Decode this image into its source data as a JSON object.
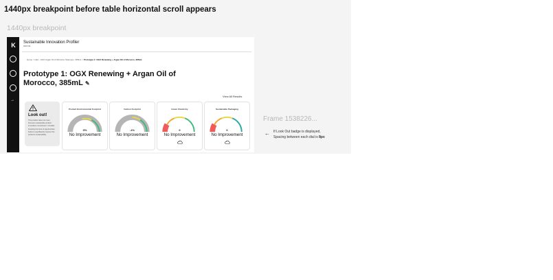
{
  "page_heading": "1440px breakpoint before table horizontal scroll appears",
  "breakpoint_label": "1440px breakpoint",
  "frame_label": "Frame 1538226...",
  "annotation": {
    "line1": "If Look Out badge is displayed,",
    "line2_prefix": "Spacing between each dial is ",
    "line2_value": "8px"
  },
  "app": {
    "title": "Sustainable Innovation Profiler",
    "subtitle": "KENVUE",
    "breadcrumb": [
      "Home",
      "LEA - OGX Argan Oil of Morocco Shampoo, 385mL",
      "Prototype 1: OGX Renewing + Argan Oil of Morocco, 385mL"
    ],
    "breadcrumb_sep": ">",
    "prototype_title": "Prototype 1: OGX Renewing + Argan Oil of Morocco, 385mL",
    "view_all": "View All Results",
    "lookout": {
      "title": "Look out!",
      "body": "This product does not meet Kenvue's sustainable product innovation commitment. Consider boosting the Area of opportunities below to significantly improve this product's sustainability."
    },
    "cards": [
      {
        "title": "Product Environmental Footprint",
        "value": "0%",
        "status": "No Improvement",
        "has_icon": false
      },
      {
        "title": "Carbon Footprint",
        "value": "-1%",
        "status": "No Improvement",
        "has_icon": false
      },
      {
        "title": "Green Chemistry",
        "value": "0",
        "status": "No Improvement",
        "has_icon": true
      },
      {
        "title": "Sustainable Packaging",
        "value": "0",
        "status": "No Improvement",
        "has_icon": true
      }
    ]
  },
  "colors": {
    "gauge_gray": "#b5b5b5",
    "gauge_red": "#ef5b5b",
    "gauge_orange": "#f5a623",
    "gauge_yellow": "#e8d84a",
    "gauge_green": "#3fb97c",
    "gauge_teal": "#29a8a0",
    "rail": "#111111"
  },
  "icons": [
    "kenvue-logo-icon",
    "leaf-icon",
    "flask-icon",
    "box-icon",
    "arrow-right-icon",
    "pencil-icon",
    "warning-icon",
    "cloud-icon",
    "arrow-left-icon"
  ]
}
